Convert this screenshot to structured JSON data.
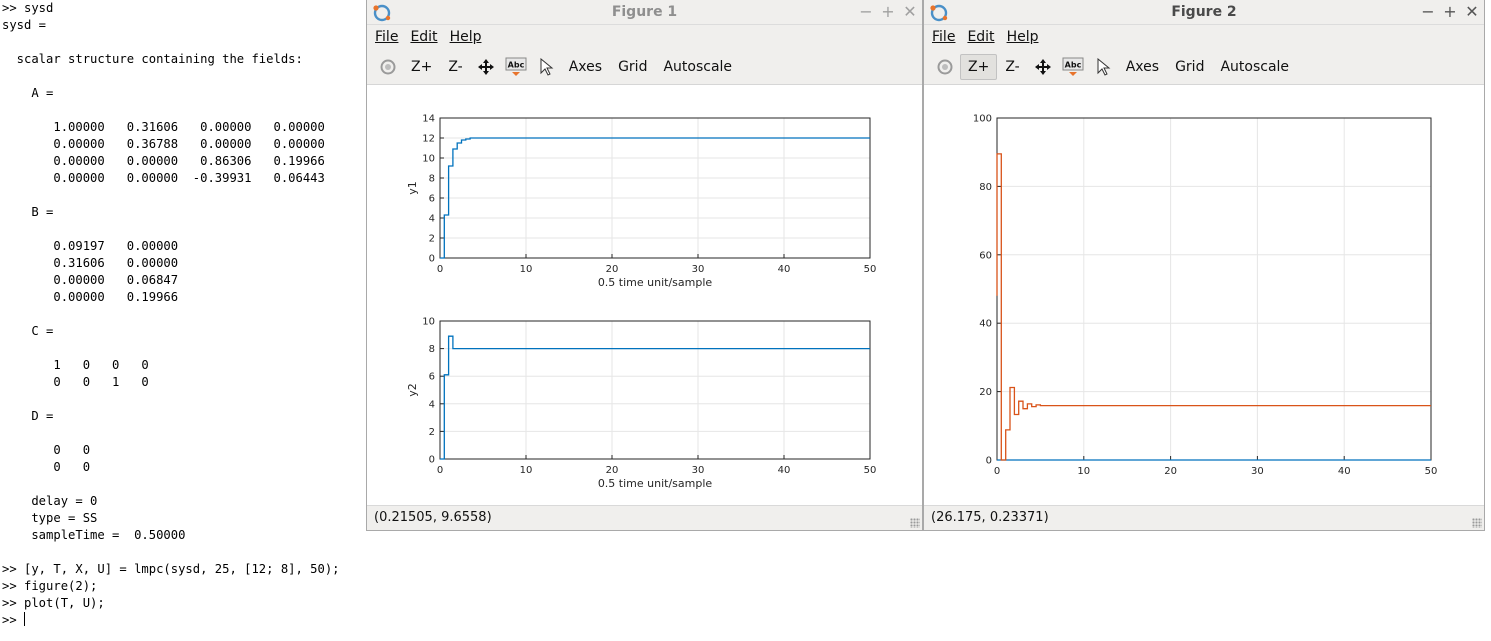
{
  "terminal": {
    "lines": [
      ">> sysd",
      "sysd =",
      "",
      "  scalar structure containing the fields:",
      "",
      "    A =",
      "",
      "       1.00000   0.31606   0.00000   0.00000",
      "       0.00000   0.36788   0.00000   0.00000",
      "       0.00000   0.00000   0.86306   0.19966",
      "       0.00000   0.00000  -0.39931   0.06443",
      "",
      "    B =",
      "",
      "       0.09197   0.00000",
      "       0.31606   0.00000",
      "       0.00000   0.06847",
      "       0.00000   0.19966",
      "",
      "    C =",
      "",
      "       1   0   0   0",
      "       0   0   1   0",
      "",
      "    D =",
      "",
      "       0   0",
      "       0   0",
      "",
      "    delay = 0",
      "    type = SS",
      "    sampleTime =  0.50000",
      "",
      ">> [y, T, X, U] = lmpc(sysd, 25, [12; 8], 50);",
      ">> figure(2);",
      ">> plot(T, U);",
      ">> "
    ]
  },
  "figure1": {
    "title": "Figure 1",
    "menu": [
      "File",
      "Edit",
      "Help"
    ],
    "toolbar": {
      "rotate_icon": "rotate-icon",
      "zoom_in": "Z+",
      "zoom_out": "Z-",
      "pan_icon": "pan-icon",
      "text_icon": "insert-text-icon",
      "select_icon": "select-arrow-icon",
      "axes": "Axes",
      "grid": "Grid",
      "autoscale": "Autoscale"
    },
    "status": "(0.21505, 9.6558)"
  },
  "figure2": {
    "title": "Figure 2",
    "menu": [
      "File",
      "Edit",
      "Help"
    ],
    "toolbar": {
      "rotate_icon": "rotate-icon",
      "zoom_in": "Z+",
      "zoom_out": "Z-",
      "pan_icon": "pan-icon",
      "text_icon": "insert-text-icon",
      "select_icon": "select-arrow-icon",
      "axes": "Axes",
      "grid": "Grid",
      "autoscale": "Autoscale"
    },
    "status": "(26.175, 0.23371)"
  },
  "colors": {
    "series1": "#0072bd",
    "series2": "#d95319",
    "grid": "#e6e6e6"
  },
  "chart_data": [
    {
      "type": "line",
      "figure": "Figure 1",
      "ylabel": "y1",
      "xlabel": "0.5 time unit/sample",
      "xlim": [
        0,
        50
      ],
      "ylim": [
        0,
        14
      ],
      "xticks": [
        0,
        10,
        20,
        30,
        40,
        50
      ],
      "yticks": [
        0,
        2,
        4,
        6,
        8,
        10,
        12,
        14
      ],
      "grid": true,
      "series": [
        {
          "x": [
            0,
            0.5,
            0.5,
            1.0,
            1.0,
            1.5,
            1.5,
            2.0,
            2.0,
            2.5,
            2.5,
            3.0,
            3.0,
            3.5,
            3.5,
            4.0,
            4.0,
            50
          ],
          "y": [
            0,
            0,
            4.3,
            4.3,
            9.2,
            9.2,
            10.9,
            10.9,
            11.5,
            11.5,
            11.8,
            11.8,
            11.9,
            11.9,
            12.0,
            12.0,
            12.0,
            12.0
          ]
        }
      ]
    },
    {
      "type": "line",
      "figure": "Figure 1",
      "ylabel": "y2",
      "xlabel": "0.5 time unit/sample",
      "xlim": [
        0,
        50
      ],
      "ylim": [
        0,
        10
      ],
      "xticks": [
        0,
        10,
        20,
        30,
        40,
        50
      ],
      "yticks": [
        0,
        2,
        4,
        6,
        8,
        10
      ],
      "grid": true,
      "series": [
        {
          "x": [
            0,
            0.5,
            0.5,
            1.0,
            1.0,
            1.5,
            1.5,
            50
          ],
          "y": [
            0,
            0,
            6.1,
            6.1,
            8.9,
            8.9,
            8.0,
            8.0
          ]
        }
      ]
    },
    {
      "type": "line",
      "figure": "Figure 2",
      "xlabel": "",
      "ylabel": "",
      "xlim": [
        0,
        50
      ],
      "ylim": [
        0,
        100
      ],
      "xticks": [
        0,
        10,
        20,
        30,
        40,
        50
      ],
      "yticks": [
        0,
        20,
        40,
        60,
        80,
        100
      ],
      "grid": true,
      "series": [
        {
          "color": "#0072bd",
          "x": [
            0,
            50
          ],
          "y": [
            0,
            0
          ]
        },
        {
          "color": "#d95319",
          "x": [
            0,
            0,
            0.5,
            0.5,
            1.0,
            1.0,
            1.5,
            1.5,
            2.0,
            2.0,
            2.5,
            2.5,
            3.0,
            3.0,
            3.5,
            3.5,
            4.0,
            4.0,
            4.5,
            4.5,
            5.0,
            5.0,
            50
          ],
          "y": [
            48,
            89.5,
            89.5,
            0,
            0,
            8.8,
            8.8,
            21.2,
            21.2,
            13.3,
            13.3,
            17.2,
            17.2,
            15.0,
            15.0,
            16.4,
            16.4,
            15.6,
            15.6,
            16.1,
            16.1,
            15.9,
            15.9
          ]
        }
      ]
    }
  ]
}
